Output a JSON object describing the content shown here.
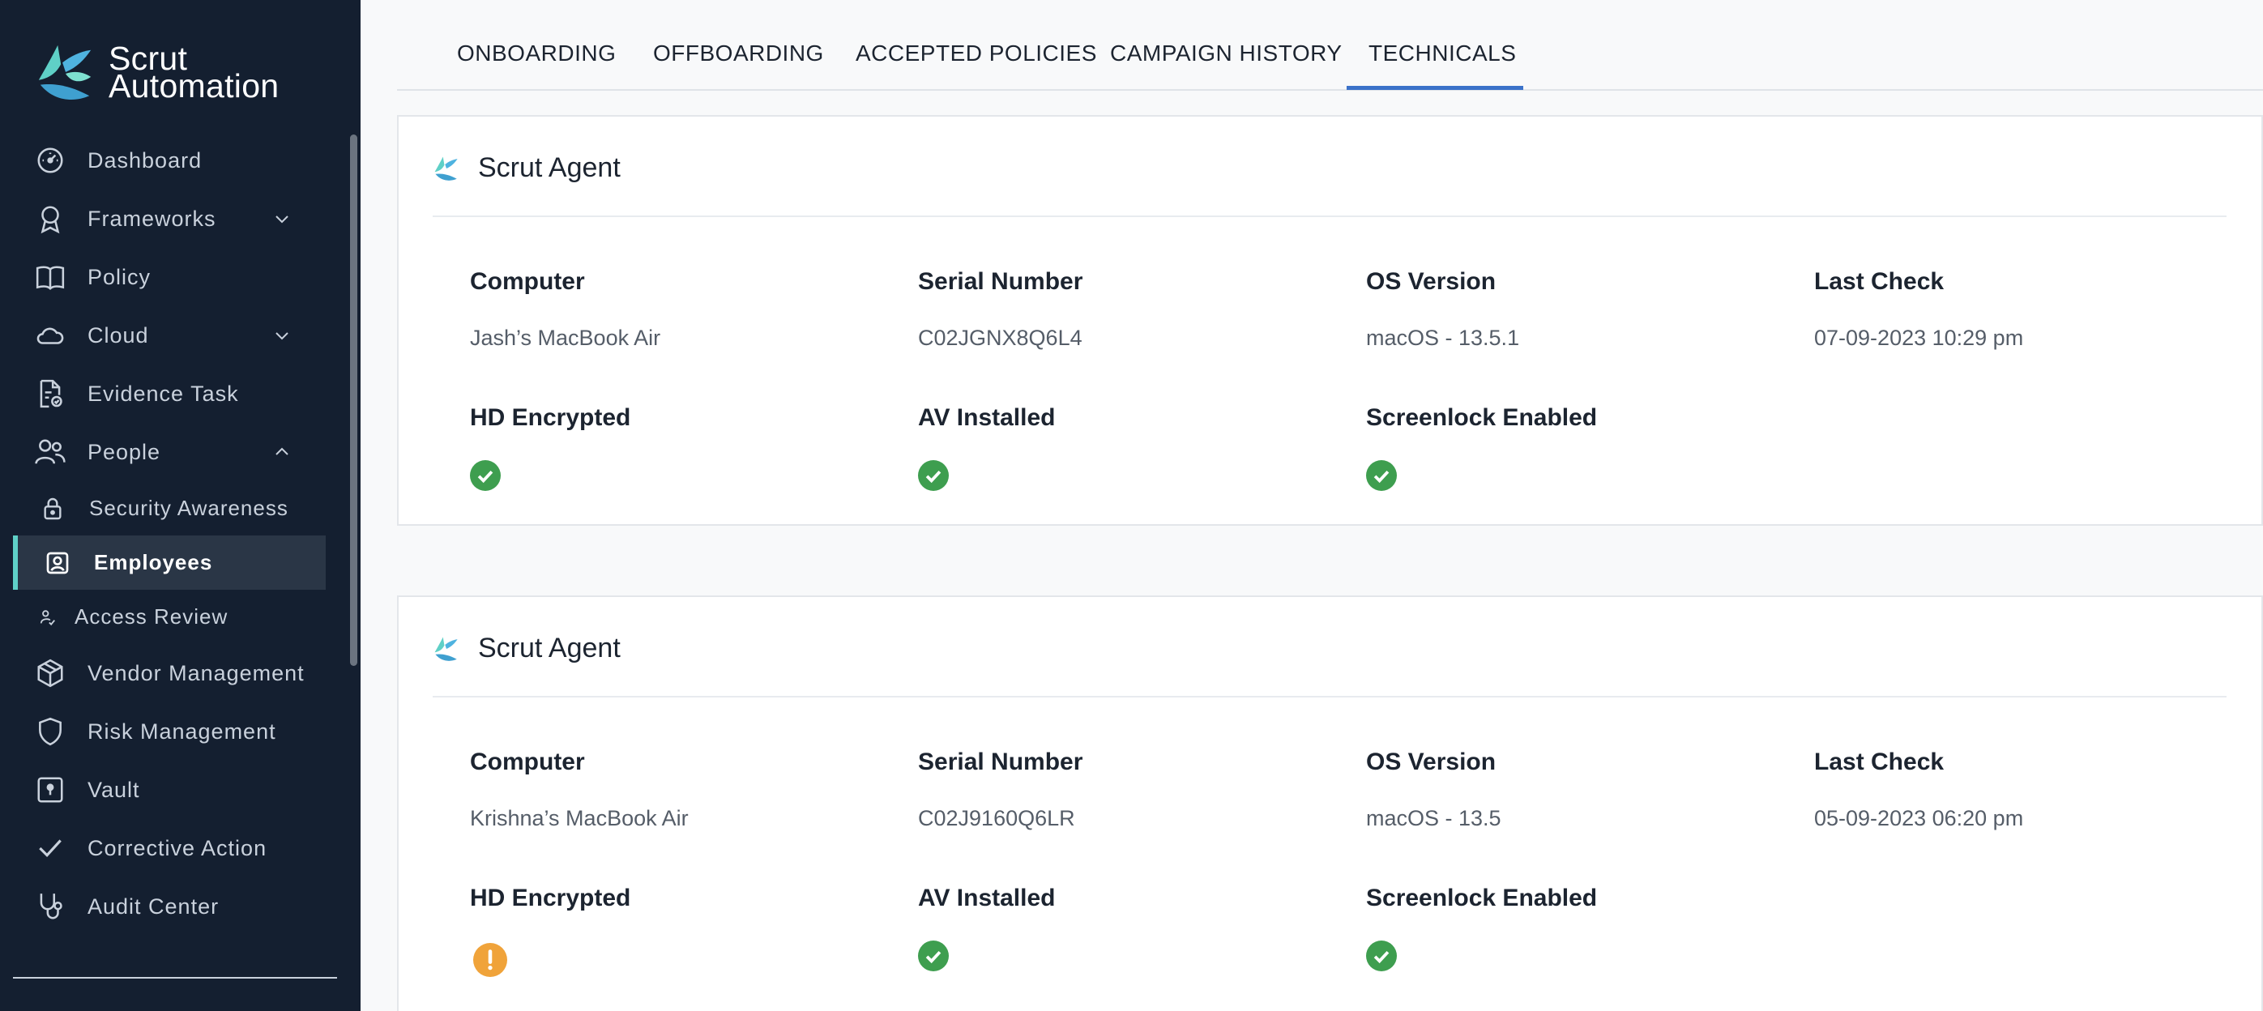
{
  "brand": {
    "line1": "Scrut",
    "line2": "Automation"
  },
  "sidebar": {
    "items": [
      {
        "label": "Dashboard",
        "icon": "dashboard-icon"
      },
      {
        "label": "Frameworks",
        "icon": "award-icon",
        "chevron": "down"
      },
      {
        "label": "Policy",
        "icon": "book-icon"
      },
      {
        "label": "Cloud",
        "icon": "cloud-icon",
        "chevron": "down"
      },
      {
        "label": "Evidence Task",
        "icon": "evidence-icon"
      },
      {
        "label": "People",
        "icon": "people-icon",
        "chevron": "up"
      }
    ],
    "people_sub": [
      {
        "label": "Security Awareness",
        "icon": "lock-icon"
      },
      {
        "label": "Employees",
        "icon": "user-badge-icon",
        "active": true
      },
      {
        "label": "Access Review",
        "icon": "access-review-icon"
      }
    ],
    "items_after": [
      {
        "label": "Vendor Management",
        "icon": "box-icon"
      },
      {
        "label": "Risk Management",
        "icon": "shield-icon"
      },
      {
        "label": "Vault",
        "icon": "vault-icon"
      },
      {
        "label": "Corrective Action",
        "icon": "check-icon"
      },
      {
        "label": "Audit Center",
        "icon": "stethoscope-icon"
      }
    ]
  },
  "tabs": [
    {
      "label": "ONBOARDING"
    },
    {
      "label": "OFFBOARDING"
    },
    {
      "label": "ACCEPTED POLICIES"
    },
    {
      "label": "CAMPAIGN HISTORY"
    },
    {
      "label": "TECHNICALS",
      "active": true
    }
  ],
  "labels": {
    "computer": "Computer",
    "serial": "Serial Number",
    "os": "OS Version",
    "last_check": "Last Check",
    "hd": "HD Encrypted",
    "av": "AV Installed",
    "screenlock": "Screenlock Enabled"
  },
  "agents": [
    {
      "title": "Scrut Agent",
      "computer": "Jash’s MacBook Air",
      "serial": "C02JGNX8Q6L4",
      "os": "macOS - 13.5.1",
      "last_check": "07-09-2023 10:29 pm",
      "hd_encrypted": "ok",
      "av_installed": "ok",
      "screenlock_enabled": "ok"
    },
    {
      "title": "Scrut Agent",
      "computer": "Krishna’s MacBook Air",
      "serial": "C02J9160Q6LR",
      "os": "macOS - 13.5",
      "last_check": "05-09-2023 06:20 pm",
      "hd_encrypted": "warning",
      "av_installed": "ok",
      "screenlock_enabled": "ok"
    }
  ],
  "colors": {
    "sidebar_bg": "#141f30",
    "accent_teal": "#5fd0c7",
    "tab_active": "#3b72c9",
    "status_ok": "#3e9e4f",
    "status_warning": "#f0a33a"
  }
}
